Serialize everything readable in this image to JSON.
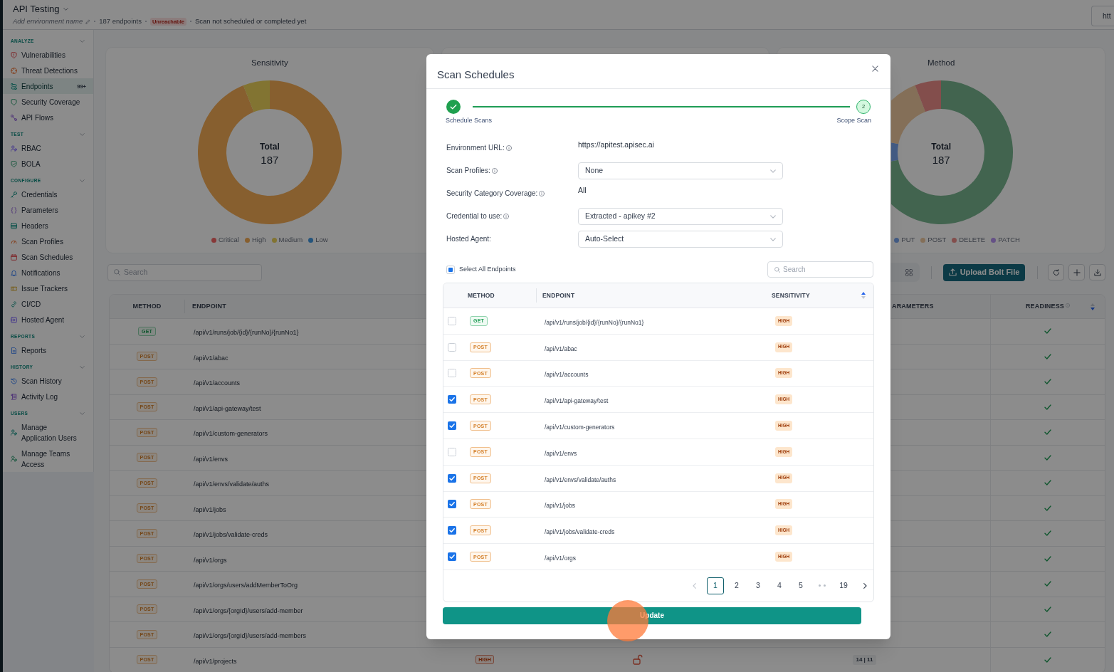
{
  "header": {
    "title": "API Testing",
    "environment_name_placeholder": "Add environment name",
    "endpoint_count": "187 endpoints",
    "status_badge": "Unreachable",
    "scan_status": "Scan not scheduled or completed yet",
    "url_field_value": "htt"
  },
  "sidebar": {
    "sections": [
      {
        "label": "ANALYZE",
        "expanded": true,
        "items": [
          {
            "label": "Vulnerabilities",
            "selected": false
          },
          {
            "label": "Threat Detections",
            "selected": false
          },
          {
            "label": "Endpoints",
            "selected": true,
            "badge": "99+"
          },
          {
            "label": "Security Coverage",
            "selected": false
          },
          {
            "label": "API Flows",
            "selected": false
          }
        ]
      },
      {
        "label": "TEST",
        "expanded": true,
        "items": [
          {
            "label": "RBAC",
            "selected": false
          },
          {
            "label": "BOLA",
            "selected": false
          }
        ]
      },
      {
        "label": "CONFIGURE",
        "expanded": true,
        "items": [
          {
            "label": "Credentials",
            "selected": false
          },
          {
            "label": "Parameters",
            "selected": false
          },
          {
            "label": "Headers",
            "selected": false
          },
          {
            "label": "Scan Profiles",
            "selected": false
          },
          {
            "label": "Scan Schedules",
            "selected": false
          },
          {
            "label": "Notifications",
            "selected": false
          },
          {
            "label": "Issue Trackers",
            "selected": false
          },
          {
            "label": "CI/CD",
            "selected": false
          },
          {
            "label": "Hosted Agent",
            "selected": false
          }
        ]
      },
      {
        "label": "REPORTS",
        "expanded": true,
        "items": [
          {
            "label": "Reports",
            "selected": false
          }
        ]
      },
      {
        "label": "HISTORY",
        "expanded": true,
        "items": [
          {
            "label": "Scan History",
            "selected": false
          },
          {
            "label": "Activity Log",
            "selected": false
          }
        ]
      },
      {
        "label": "USERS",
        "expanded": true,
        "items": [
          {
            "label": "Manage Application Users",
            "selected": false
          },
          {
            "label": "Manage Teams Access",
            "selected": false
          }
        ]
      }
    ]
  },
  "charts": [
    {
      "center_label": "Total",
      "center_value": "187",
      "legend": [
        {
          "color": "#873838"
        },
        {
          "color": "#875f2f"
        },
        {
          "color": "#827432"
        },
        {
          "color": "#24547c"
        }
      ],
      "chart_data": {
        "type": "donut",
        "title": "Sensitivity",
        "categories": [
          "Critical",
          "High",
          "Medium",
          "Low"
        ],
        "values": [
          0,
          94,
          6,
          0
        ]
      }
    },
    {
      "title": "Method",
      "center_label": "Total",
      "center_value": "187",
      "legend": [
        {
          "label": "PUT",
          "color": "#425a82"
        },
        {
          "label": "POST",
          "color": "#846f58"
        },
        {
          "label": "DELETE",
          "color": "#834e4c"
        },
        {
          "label": "PATCH",
          "color": "#655186"
        }
      ]
    }
  ],
  "search": {
    "placeholder": "Search"
  },
  "toolbar": {
    "upload_button": "Upload Bolt File"
  },
  "endpoints_table": {
    "columns": [
      {
        "label": "METHOD"
      },
      {
        "label": "ENDPOINT"
      },
      {
        "label": "ARAMETERS"
      },
      {
        "label": "READINESS",
        "info": true,
        "sort_ascending": false
      }
    ],
    "rows": [
      {
        "method": "GET",
        "kind": "get",
        "endpoint": "/api/v1/runs/job/{id}/{runNo}/{runNo1}",
        "ready": true
      },
      {
        "method": "POST",
        "kind": "post",
        "endpoint": "/api/v1/abac",
        "ready": true
      },
      {
        "method": "POST",
        "kind": "post",
        "endpoint": "/api/v1/accounts",
        "ready": true
      },
      {
        "method": "POST",
        "kind": "post",
        "endpoint": "/api/v1/api-gateway/test",
        "ready": true
      },
      {
        "method": "POST",
        "kind": "post",
        "endpoint": "/api/v1/custom-generators",
        "ready": true
      },
      {
        "method": "POST",
        "kind": "post",
        "endpoint": "/api/v1/envs",
        "ready": true
      },
      {
        "method": "POST",
        "kind": "post",
        "endpoint": "/api/v1/envs/validate/auths",
        "ready": true
      },
      {
        "method": "POST",
        "kind": "post",
        "endpoint": "/api/v1/jobs",
        "ready": true
      },
      {
        "method": "POST",
        "kind": "post",
        "endpoint": "/api/v1/jobs/validate-creds",
        "ready": true
      },
      {
        "method": "POST",
        "kind": "post",
        "endpoint": "/api/v1/orgs",
        "ready": true
      },
      {
        "method": "POST",
        "kind": "post",
        "endpoint": "/api/v1/orgs/users/addMemberToOrg",
        "ready": true
      },
      {
        "method": "POST",
        "kind": "post",
        "endpoint": "/api/v1/orgs/{orgId}/users/add-member",
        "ready": true
      },
      {
        "method": "POST",
        "kind": "post",
        "endpoint": "/api/v1/orgs/{orgId}/users/add-members",
        "ready": true
      },
      {
        "method": "POST",
        "kind": "post",
        "endpoint": "/api/v1/projects",
        "sensitivity": "HIGH",
        "locked": true,
        "column_5": "14 | 11",
        "ready": true
      }
    ]
  },
  "modal": {
    "title": "Scan Schedules",
    "steps": [
      {
        "label": "Schedule Scans",
        "completed": true
      },
      {
        "label": "Scope Scan",
        "number": "2",
        "completed": false
      }
    ],
    "fields": [
      {
        "label": "Environment URL:",
        "info": true,
        "kind": "text",
        "value": "https://apitest.apisec.ai"
      },
      {
        "label": "Scan Profiles:",
        "info": true,
        "kind": "select",
        "value": "None"
      },
      {
        "label": "Security Category Coverage:",
        "info": true,
        "kind": "text",
        "value": "All"
      },
      {
        "label": "Credential to use:",
        "info": true,
        "kind": "select",
        "value": "Extracted - apikey #2"
      },
      {
        "label": "Hosted Agent:",
        "info": false,
        "kind": "select",
        "value": "Auto-Select"
      }
    ],
    "select_all": {
      "label": "Select All Endpoints",
      "checked": false,
      "indeterminate": true
    },
    "search": {
      "placeholder": "Search"
    },
    "table": {
      "columns": [
        {
          "label": "METHOD"
        },
        {
          "label": "ENDPOINT"
        },
        {
          "label": "SENSITIVITY",
          "sort_ascending": true
        }
      ],
      "rows": [
        {
          "checked": false,
          "method": "GET",
          "kind": "get",
          "endpoint": "/api/v1/runs/job/{id}/{runNo}/{runNo1}",
          "sensitivity": "HIGH"
        },
        {
          "checked": false,
          "method": "POST",
          "kind": "post",
          "endpoint": "/api/v1/abac",
          "sensitivity": "HIGH"
        },
        {
          "checked": false,
          "method": "POST",
          "kind": "post",
          "endpoint": "/api/v1/accounts",
          "sensitivity": "HIGH"
        },
        {
          "checked": true,
          "method": "POST",
          "kind": "post",
          "endpoint": "/api/v1/api-gateway/test",
          "sensitivity": "HIGH"
        },
        {
          "checked": true,
          "method": "POST",
          "kind": "post",
          "endpoint": "/api/v1/custom-generators",
          "sensitivity": "HIGH"
        },
        {
          "checked": false,
          "method": "POST",
          "kind": "post",
          "endpoint": "/api/v1/envs",
          "sensitivity": "HIGH"
        },
        {
          "checked": true,
          "method": "POST",
          "kind": "post",
          "endpoint": "/api/v1/envs/validate/auths",
          "sensitivity": "HIGH"
        },
        {
          "checked": true,
          "method": "POST",
          "kind": "post",
          "endpoint": "/api/v1/jobs",
          "sensitivity": "HIGH"
        },
        {
          "checked": true,
          "method": "POST",
          "kind": "post",
          "endpoint": "/api/v1/jobs/validate-creds",
          "sensitivity": "HIGH"
        },
        {
          "checked": true,
          "method": "POST",
          "kind": "post",
          "endpoint": "/api/v1/orgs",
          "sensitivity": "HIGH"
        }
      ]
    },
    "pagination": {
      "prev_disabled": true,
      "next_disabled": false,
      "items": [
        {
          "kind": "page",
          "label": "1",
          "selected": true
        },
        {
          "kind": "page",
          "label": "2",
          "selected": false
        },
        {
          "kind": "page",
          "label": "3",
          "selected": false
        },
        {
          "kind": "page",
          "label": "4",
          "selected": false
        },
        {
          "kind": "page",
          "label": "5",
          "selected": false
        },
        {
          "kind": "ellipsis",
          "selected": false
        },
        {
          "kind": "page",
          "label": "19",
          "selected": false
        }
      ]
    },
    "update_button": "Update"
  }
}
